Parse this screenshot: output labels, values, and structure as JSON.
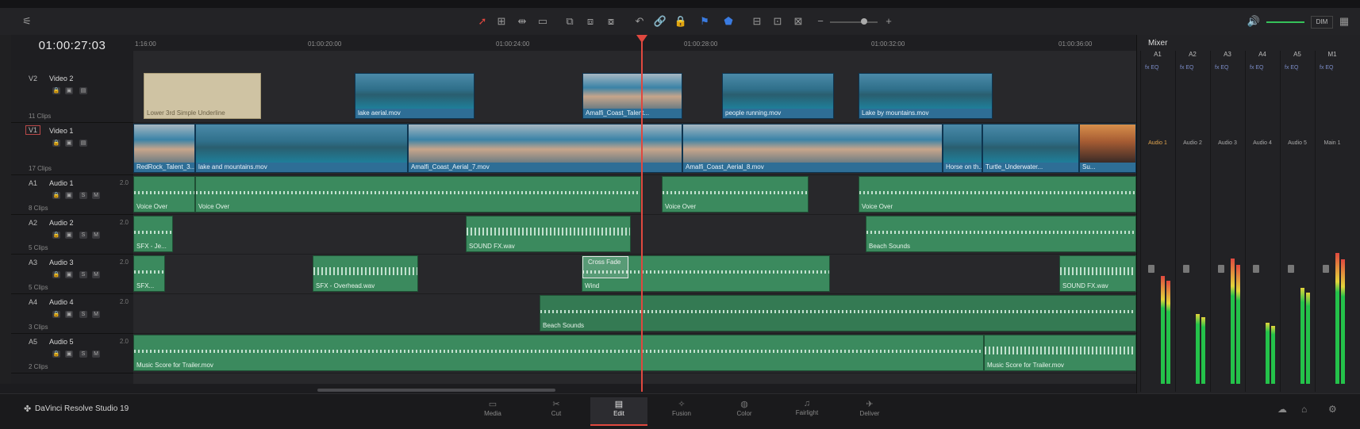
{
  "timecode": "01:00:27:03",
  "ruler_ticks": [
    "1:16:00",
    "01:00:20:00",
    "01:00:24:00",
    "01:00:28:00",
    "01:00:32:00",
    "01:00:36:00"
  ],
  "toolbar": {
    "dim_label": "DIM"
  },
  "tracks": [
    {
      "id": "V2",
      "name": "Video 2",
      "clips": "11 Clips",
      "vol": ""
    },
    {
      "id": "V1",
      "name": "Video 1",
      "clips": "17 Clips",
      "vol": ""
    },
    {
      "id": "A1",
      "name": "Audio 1",
      "clips": "8 Clips",
      "vol": "2.0"
    },
    {
      "id": "A2",
      "name": "Audio 2",
      "clips": "5 Clips",
      "vol": "2.0"
    },
    {
      "id": "A3",
      "name": "Audio 3",
      "clips": "5 Clips",
      "vol": "2.0"
    },
    {
      "id": "A4",
      "name": "Audio 4",
      "clips": "3 Clips",
      "vol": "2.0"
    },
    {
      "id": "A5",
      "name": "Audio 5",
      "clips": "2 Clips",
      "vol": "2.0"
    }
  ],
  "video_clips": {
    "v2": [
      "Lower 3rd Simple Underline",
      "lake aerial.mov",
      "Amalfi_Coast_Talent...",
      "people running.mov",
      "Lake by mountains.mov"
    ],
    "v1": [
      "RedRock_Talent_3...",
      "lake and mountains.mov",
      "Amalfi_Coast_Aerial_7.mov",
      "Amalfi_Coast_Aerial_8.mov",
      "Horse on th...",
      "Turtle_Underwater...",
      "Su..."
    ]
  },
  "audio_clips": {
    "a1": [
      "Voice Over",
      "Voice Over",
      "Voice Over",
      "Voice Over"
    ],
    "a2": [
      "SFX - Je...",
      "SOUND FX.wav",
      "Beach Sounds"
    ],
    "a3": [
      "SFX...",
      "SFX - Overhead.wav",
      "Cross Fade",
      "Wind",
      "SOUND FX.wav"
    ],
    "a4": [
      "Beach Sounds"
    ],
    "a5": [
      "Music Score for Trailer.mov",
      "Music Score for Trailer.mov"
    ]
  },
  "mixer": {
    "title": "Mixer",
    "columns": [
      "A1",
      "A2",
      "A3",
      "A4",
      "A5",
      "M1"
    ],
    "channels": [
      "Audio 1",
      "Audio 2",
      "Audio 3",
      "Audio 4",
      "Audio 5",
      "Main 1"
    ],
    "levels": [
      0.62,
      0.4,
      0.72,
      0.35,
      0.55,
      0.75
    ]
  },
  "app_name": "DaVinci Resolve Studio 19",
  "pages": [
    "Media",
    "Cut",
    "Edit",
    "Fusion",
    "Color",
    "Fairlight",
    "Deliver"
  ],
  "active_page": "Edit"
}
